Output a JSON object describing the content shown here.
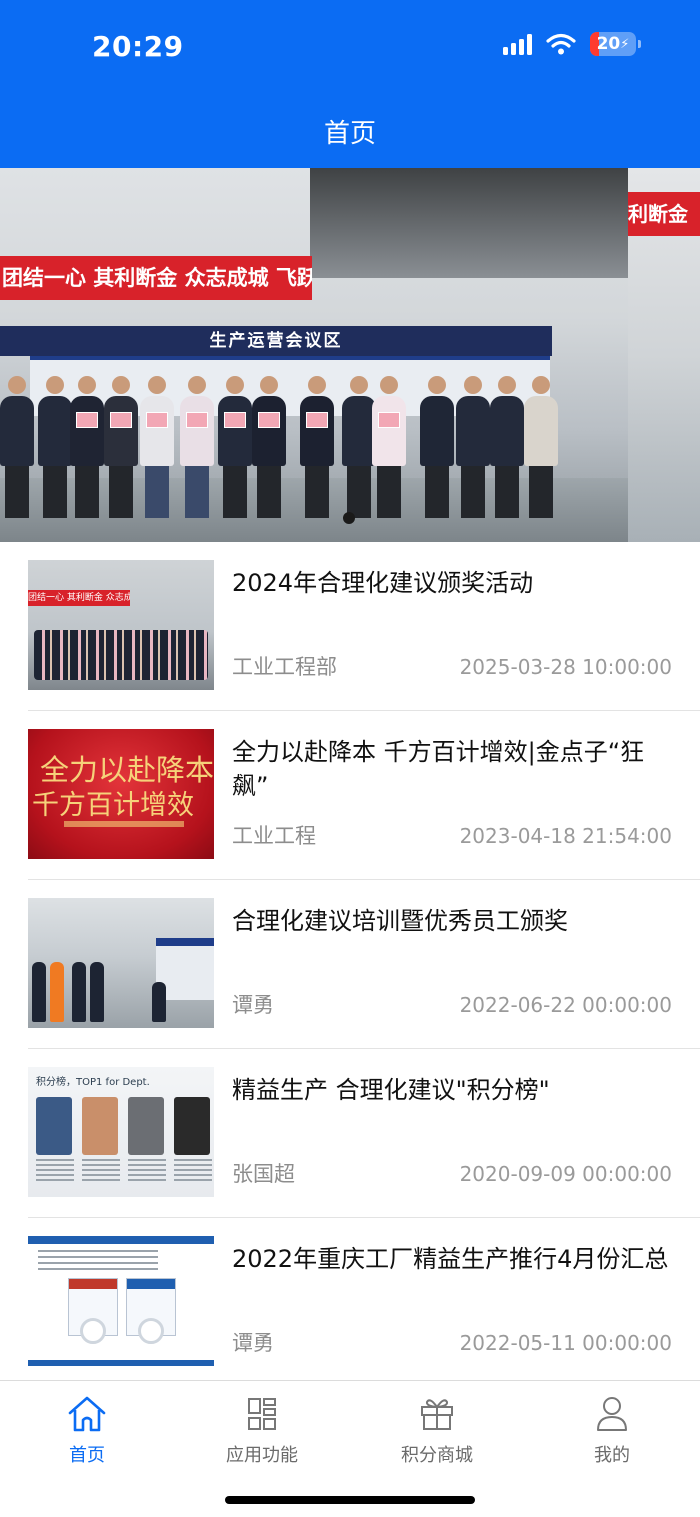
{
  "status_bar": {
    "time": "20:29",
    "battery": "20",
    "signal_icon": "cellular-signal-icon",
    "wifi_icon": "wifi-icon",
    "battery_icon": "battery-charging-icon"
  },
  "header": {
    "title": "首页",
    "background_color": "#0b6cf3"
  },
  "banner": {
    "slogan": "团结一心 其利断金 众志成城 飞跃巅峰",
    "slogan_next": "利断金",
    "sign": "生产运营会议区",
    "active_slide": 1
  },
  "news": [
    {
      "title": "2024年合理化建议颁奖活动",
      "author": "工业工程部",
      "date": "2025-03-28 10:00:00"
    },
    {
      "title": "全力以赴降本 千方百计增效|金点子“狂飙”",
      "author": "工业工程",
      "date": "2023-04-18 21:54:00",
      "thumb_text_1": "全力以赴降本",
      "thumb_text_2": "千方百计增效"
    },
    {
      "title": "合理化建议培训暨优秀员工颁奖",
      "author": "谭勇",
      "date": "2022-06-22 00:00:00"
    },
    {
      "title": "精益生产 合理化建议\"积分榜\"",
      "author": "张国超",
      "date": "2020-09-09 00:00:00",
      "thumb_text": "积分榜，TOP1 for Dept."
    },
    {
      "title": "2022年重庆工厂精益生产推行4月份汇总",
      "author": "谭勇",
      "date": "2022-05-11 00:00:00"
    }
  ],
  "tabbar": {
    "tabs": [
      {
        "label": "首页",
        "icon": "home-icon",
        "active": true
      },
      {
        "label": "应用功能",
        "icon": "grid-apps-icon",
        "active": false
      },
      {
        "label": "积分商城",
        "icon": "gift-icon",
        "active": false
      },
      {
        "label": "我的",
        "icon": "user-icon",
        "active": false
      }
    ],
    "active_color": "#0b6cf3",
    "inactive_color": "#6b6b6b"
  }
}
